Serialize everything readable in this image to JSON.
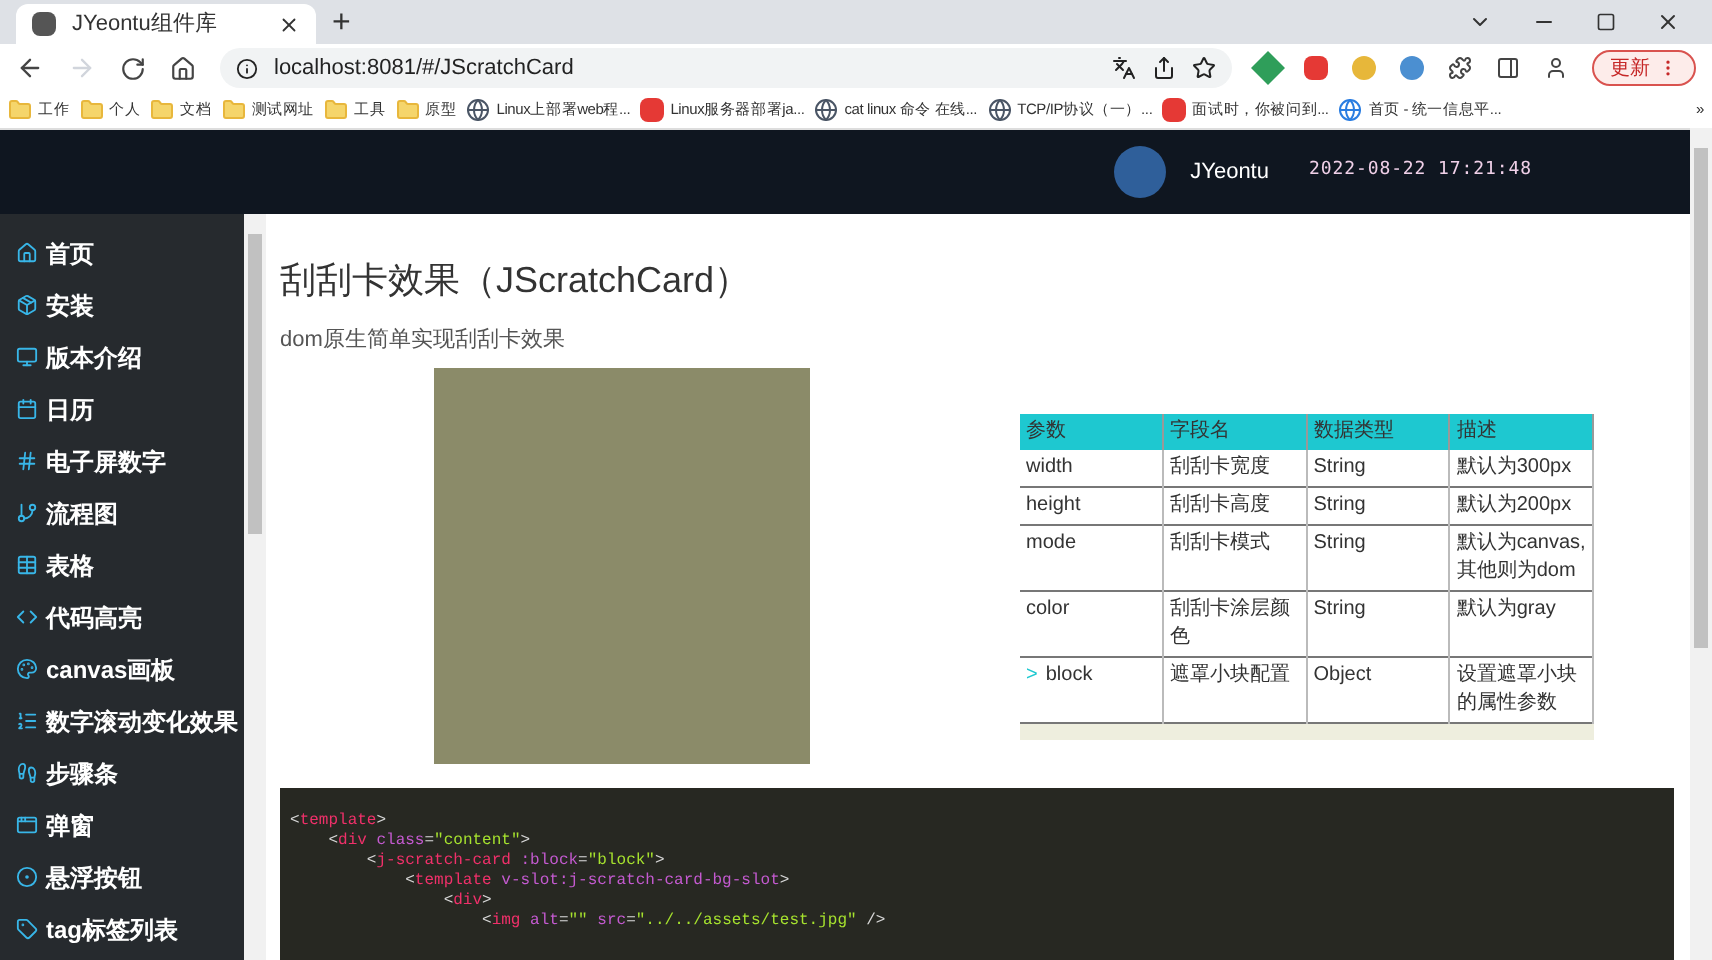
{
  "browser": {
    "tab_title": "JYeontu组件库",
    "new_tab": "+",
    "address": "localhost:8081/#/JScratchCard",
    "update_button": "更新",
    "bookmarks": [
      {
        "kind": "folder",
        "label": "工作"
      },
      {
        "kind": "folder",
        "label": "个人"
      },
      {
        "kind": "folder",
        "label": "文档"
      },
      {
        "kind": "folder",
        "label": "测试网址"
      },
      {
        "kind": "folder",
        "label": "工具"
      },
      {
        "kind": "folder",
        "label": "原型"
      },
      {
        "kind": "site",
        "label": "Linux上部署web程..."
      },
      {
        "kind": "red",
        "label": "Linux服务器部署ja..."
      },
      {
        "kind": "site",
        "label": "cat linux 命令 在线..."
      },
      {
        "kind": "site",
        "label": "TCP/IP协议（一）..."
      },
      {
        "kind": "red",
        "label": "面试时，你被问到..."
      },
      {
        "kind": "globe",
        "label": "首页 - 统一信息平..."
      }
    ],
    "more": "»"
  },
  "header": {
    "user": "JYeontu",
    "datetime": "2022-08-22 17:21:48"
  },
  "sidebar": {
    "items": [
      {
        "label": "首页",
        "selected": false
      },
      {
        "label": "安装",
        "selected": false
      },
      {
        "label": "版本介绍",
        "selected": false
      },
      {
        "label": "日历",
        "selected": false
      },
      {
        "label": "电子屏数字",
        "selected": false
      },
      {
        "label": "流程图",
        "selected": false
      },
      {
        "label": "表格",
        "selected": false
      },
      {
        "label": "代码高亮",
        "selected": false
      },
      {
        "label": "canvas画板",
        "selected": false
      },
      {
        "label": "数字滚动变化效果",
        "selected": false
      },
      {
        "label": "步骤条",
        "selected": false
      },
      {
        "label": "弹窗",
        "selected": false
      },
      {
        "label": "悬浮按钮",
        "selected": false
      },
      {
        "label": "tag标签列表",
        "selected": false
      }
    ]
  },
  "content": {
    "title": "刮刮卡效果（JScratchCard）",
    "description": "dom原生简单实现刮刮卡效果",
    "table": {
      "columns": [
        "参数",
        "字段名",
        "数据类型",
        "描述"
      ],
      "rows": [
        {
          "cells": [
            "width",
            "刮刮卡宽度",
            "String",
            "默认为300px"
          ]
        },
        {
          "cells": [
            "height",
            "刮刮卡高度",
            "String",
            "默认为200px"
          ]
        },
        {
          "cells": [
            "mode",
            "刮刮卡模式",
            "String",
            "默认为canvas,其他则为dom"
          ]
        },
        {
          "cells": [
            "color",
            "刮刮卡涂层颜色",
            "String",
            "默认为gray"
          ]
        },
        {
          "expand_marker": ">",
          "cells": [
            "block",
            "遮罩小块配置",
            "Object",
            "设置遮罩小块的属性参数"
          ]
        }
      ]
    },
    "code": [
      [
        {
          "kind": "punct",
          "text": "<"
        },
        {
          "kind": "tag",
          "text": "template"
        },
        {
          "kind": "punct",
          "text": ">"
        }
      ],
      [
        {
          "kind": "punct",
          "text": "    <"
        },
        {
          "kind": "tag",
          "text": "div "
        },
        {
          "kind": "attr",
          "text": "class"
        },
        {
          "kind": "punct",
          "text": "="
        },
        {
          "kind": "string",
          "text": "\"content\""
        },
        {
          "kind": "punct",
          "text": ">"
        }
      ],
      [
        {
          "kind": "punct",
          "text": "        <"
        },
        {
          "kind": "tag",
          "text": "j-scratch-card "
        },
        {
          "kind": "attr",
          "text": ":block"
        },
        {
          "kind": "punct",
          "text": "="
        },
        {
          "kind": "string",
          "text": "\"block\""
        },
        {
          "kind": "punct",
          "text": ">"
        }
      ],
      [
        {
          "kind": "punct",
          "text": "            <"
        },
        {
          "kind": "tag",
          "text": "template "
        },
        {
          "kind": "attr",
          "text": "v-slot:j-scratch-card-bg-slot"
        },
        {
          "kind": "punct",
          "text": ">"
        }
      ],
      [
        {
          "kind": "punct",
          "text": "                <"
        },
        {
          "kind": "tag",
          "text": "div"
        },
        {
          "kind": "punct",
          "text": ">"
        }
      ],
      [
        {
          "kind": "punct",
          "text": "                    <"
        },
        {
          "kind": "tag",
          "text": "img "
        },
        {
          "kind": "attr",
          "text": "alt"
        },
        {
          "kind": "punct",
          "text": "="
        },
        {
          "kind": "string",
          "text": "\"\" "
        },
        {
          "kind": "attr",
          "text": "src"
        },
        {
          "kind": "punct",
          "text": "="
        },
        {
          "kind": "string",
          "text": "\"../../assets/test.jpg\""
        },
        {
          "kind": "punct",
          "text": " />"
        }
      ]
    ]
  }
}
